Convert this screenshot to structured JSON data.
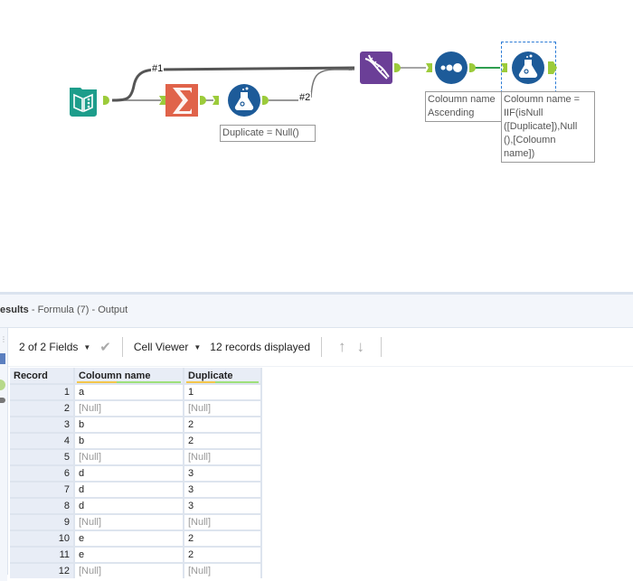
{
  "canvas": {
    "wire_labels": {
      "w1": "#1",
      "w2": "#2"
    },
    "tools": [
      {
        "id": "input",
        "icon": "book-icon",
        "color": "#1d9d8b"
      },
      {
        "id": "summarize",
        "icon": "sigma-icon",
        "color": "#e0634a"
      },
      {
        "id": "formula-1",
        "icon": "flask-icon",
        "color": "#1d5b99"
      },
      {
        "id": "join",
        "icon": "dna-icon",
        "color": "#6b3f97"
      },
      {
        "id": "sort",
        "icon": "dots-icon",
        "color": "#1d5b99"
      },
      {
        "id": "formula-2",
        "icon": "flask-icon",
        "color": "#1d5b99"
      }
    ],
    "annotations": {
      "formula1": "Duplicate = Null()",
      "sort": "Coloumn name\nAscending",
      "formula2": "Coloumn name =\nIIF(isNull\n([Duplicate]),Null\n(),[Coloumn\nname])"
    },
    "anchor_color": "#9ccb3b",
    "wire_color": "#555555",
    "active_wire_color": "#2e9e4f"
  },
  "results": {
    "title_bold": "esults",
    "title_rest": " - Formula (7) - Output",
    "toolbar": {
      "fields_label": "2 of 2 Fields",
      "cell_viewer_label": "Cell Viewer",
      "records_label": "12 records displayed"
    },
    "table": {
      "columns": [
        "Record",
        "Coloumn name",
        "Duplicate"
      ],
      "rows": [
        [
          "1",
          "a",
          "1"
        ],
        [
          "2",
          "[Null]",
          "[Null]"
        ],
        [
          "3",
          "b",
          "2"
        ],
        [
          "4",
          "b",
          "2"
        ],
        [
          "5",
          "[Null]",
          "[Null]"
        ],
        [
          "6",
          "d",
          "3"
        ],
        [
          "7",
          "d",
          "3"
        ],
        [
          "8",
          "d",
          "3"
        ],
        [
          "9",
          "[Null]",
          "[Null]"
        ],
        [
          "10",
          "e",
          "2"
        ],
        [
          "11",
          "e",
          "2"
        ],
        [
          "12",
          "[Null]",
          "[Null]"
        ]
      ]
    }
  }
}
